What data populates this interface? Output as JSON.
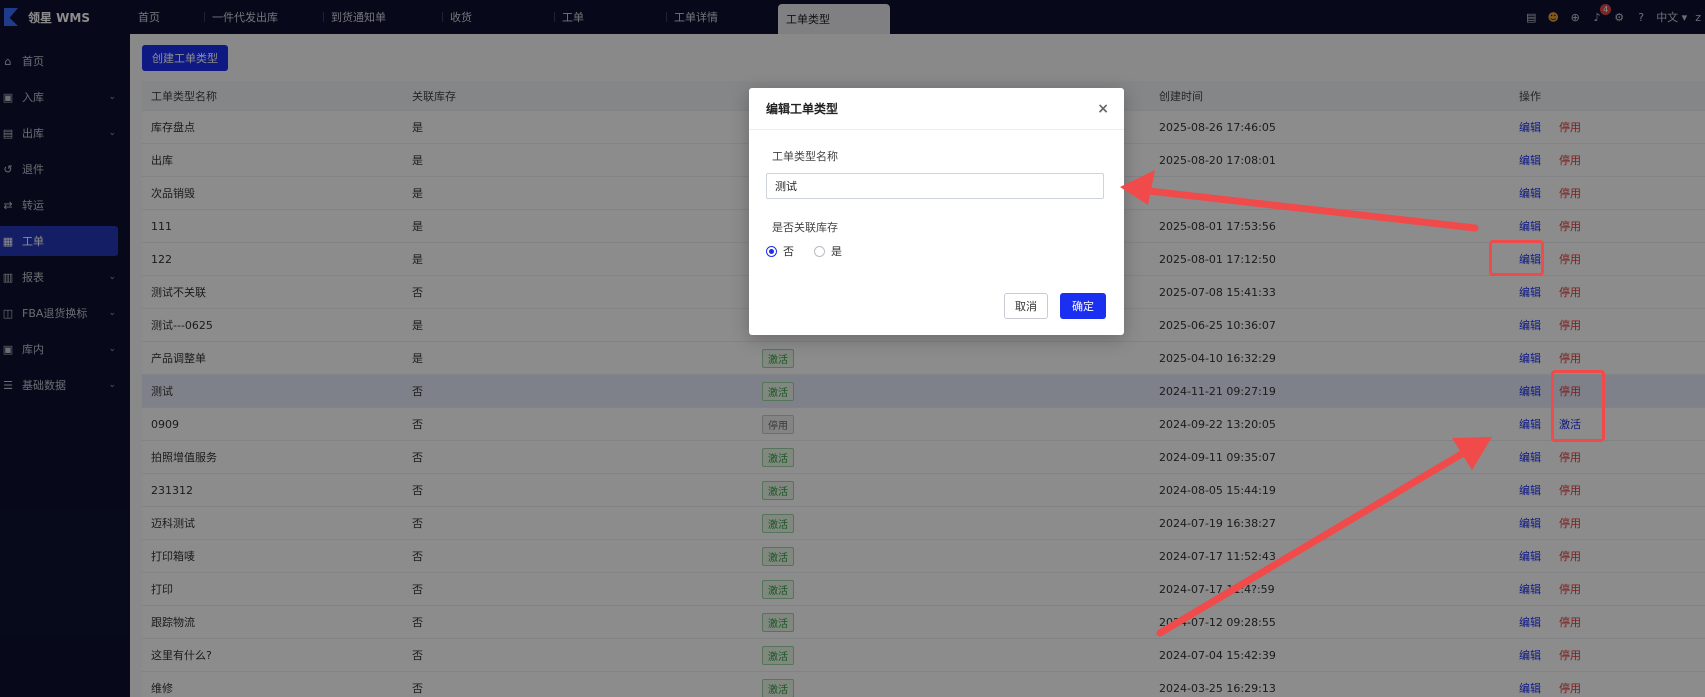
{
  "app": {
    "logo_text": "领星 WMS"
  },
  "tabs": [
    "首页",
    "一件代发出库",
    "到货通知单",
    "收货",
    "工单",
    "工单详情",
    "工单类型"
  ],
  "active_tab": "工单类型",
  "topbar": {
    "language": "中文",
    "notification_count": "4",
    "user_initials": "z"
  },
  "sidebar": [
    {
      "label": "首页",
      "icon": "home-icon",
      "chevron": ""
    },
    {
      "label": "入库",
      "icon": "inbound-icon",
      "chevron": "⌄"
    },
    {
      "label": "出库",
      "icon": "outbound-icon",
      "chevron": "⌄"
    },
    {
      "label": "退件",
      "icon": "return-icon",
      "chevron": ""
    },
    {
      "label": "转运",
      "icon": "transfer-icon",
      "chevron": ""
    },
    {
      "label": "工单",
      "icon": "workorder-icon",
      "chevron": ""
    },
    {
      "label": "报表",
      "icon": "report-icon",
      "chevron": "⌄"
    },
    {
      "label": "FBA退货换标",
      "icon": "fba-icon",
      "chevron": "⌄"
    },
    {
      "label": "库内",
      "icon": "warehouse-icon",
      "chevron": "⌄"
    },
    {
      "label": "基础数据",
      "icon": "data-icon",
      "chevron": "⌄"
    }
  ],
  "toolbar": {
    "create_label": "创建工单类型"
  },
  "table": {
    "headers": [
      "工单类型名称",
      "关联库存",
      "",
      "创建时间",
      "操作"
    ],
    "rows": [
      {
        "name": "库存盘点",
        "linked": "是",
        "status": "",
        "created": "2025-08-26 17:46:05",
        "action2": "停用"
      },
      {
        "name": "出库",
        "linked": "是",
        "status": "",
        "created": "2025-08-20 17:08:01",
        "action2": "停用"
      },
      {
        "name": "次品销毁",
        "linked": "是",
        "status": "",
        "created": "",
        "action2": "停用"
      },
      {
        "name": "111",
        "linked": "是",
        "status": "",
        "created": "2025-08-01 17:53:56",
        "action2": "停用"
      },
      {
        "name": "122",
        "linked": "是",
        "status": "",
        "created": "2025-08-01 17:12:50",
        "action2": "停用"
      },
      {
        "name": "测试不关联",
        "linked": "否",
        "status": "",
        "created": "2025-07-08 15:41:33",
        "action2": "停用"
      },
      {
        "name": "测试---0625",
        "linked": "是",
        "status": "",
        "created": "2025-06-25 10:36:07",
        "action2": "停用"
      },
      {
        "name": "产品调整单",
        "linked": "是",
        "status": "激活",
        "created": "2025-04-10 16:32:29",
        "action2": "停用"
      },
      {
        "name": "测试",
        "linked": "否",
        "status": "激活",
        "created": "2024-11-21 09:27:19",
        "action2": "停用"
      },
      {
        "name": "0909",
        "linked": "否",
        "status": "停用",
        "created": "2024-09-22 13:20:05",
        "action2": "激活"
      },
      {
        "name": "拍照增值服务",
        "linked": "否",
        "status": "激活",
        "created": "2024-09-11 09:35:07",
        "action2": "停用"
      },
      {
        "name": "231312",
        "linked": "否",
        "status": "激活",
        "created": "2024-08-05 15:44:19",
        "action2": "停用"
      },
      {
        "name": "迈科测试",
        "linked": "否",
        "status": "激活",
        "created": "2024-07-19 16:38:27",
        "action2": "停用"
      },
      {
        "name": "打印箱唛",
        "linked": "否",
        "status": "激活",
        "created": "2024-07-17 11:52:43",
        "action2": "停用"
      },
      {
        "name": "打印",
        "linked": "否",
        "status": "激活",
        "created": "2024-07-17 11:4?:59",
        "action2": "停用"
      },
      {
        "name": "跟踪物流",
        "linked": "否",
        "status": "激活",
        "created": "2024-07-12 09:28:55",
        "action2": "停用"
      },
      {
        "name": "这里有什么?",
        "linked": "否",
        "status": "激活",
        "created": "2024-07-04 15:42:39",
        "action2": "停用"
      },
      {
        "name": "维修",
        "linked": "否",
        "status": "激活",
        "created": "2024-03-25 16:29:13",
        "action2": "停用"
      }
    ],
    "edit_label": "编辑"
  },
  "modal": {
    "title": "编辑工单类型",
    "close": "×",
    "name_label": "工单类型名称",
    "name_value": "测试",
    "stock_label": "是否关联库存",
    "option_no": "否",
    "option_yes": "是",
    "selected": "否",
    "cancel": "取消",
    "ok": "确定"
  },
  "colors": {
    "primary": "#1a2ff0",
    "danger": "#e03a3a",
    "annotation": "#f04a4a",
    "nav_bg": "#0d1230"
  }
}
